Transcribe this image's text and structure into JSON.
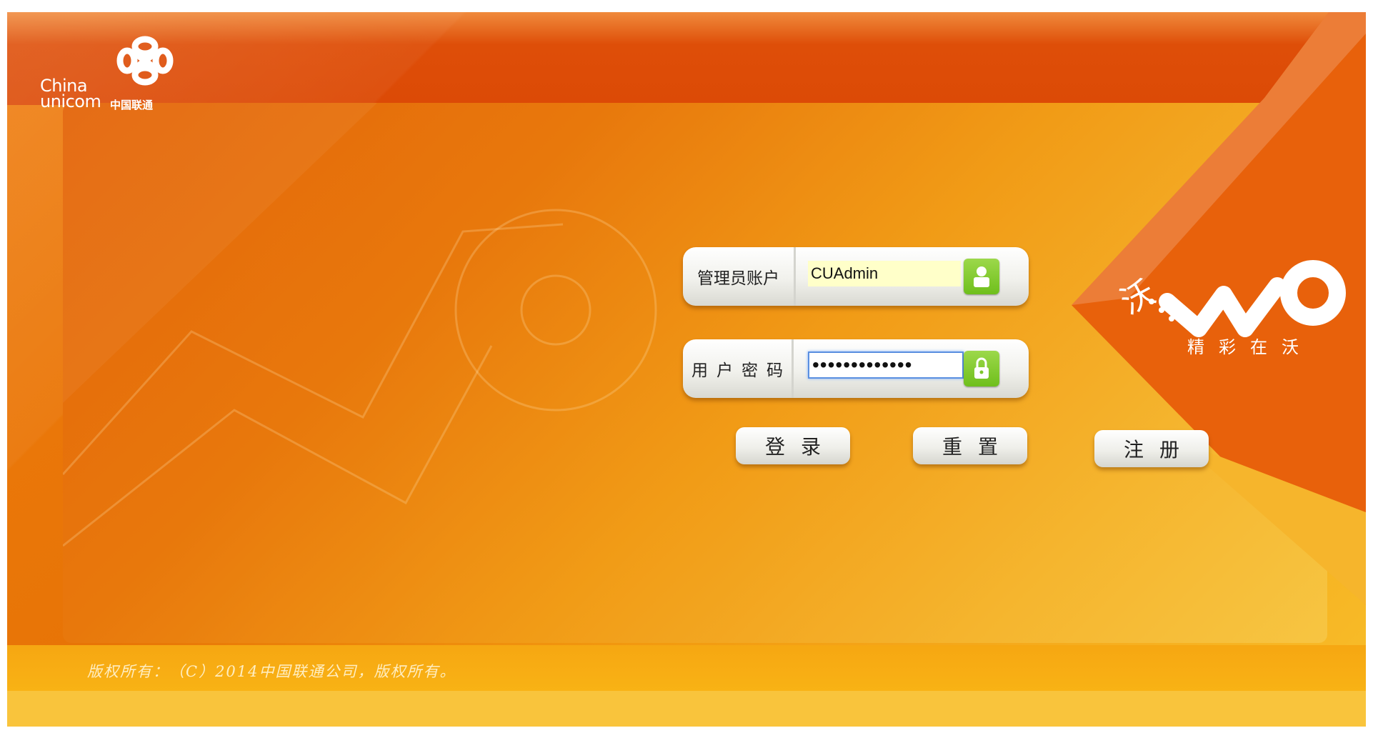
{
  "brand": {
    "name_en": "China\nunicom",
    "name_cn": "中国联通"
  },
  "form": {
    "account_label": "管理员账户",
    "account_value": "CUAdmin",
    "password_label": "用户密码",
    "password_value": "•••••••••••••"
  },
  "buttons": {
    "login": "登录",
    "reset": "重置",
    "register": "注册"
  },
  "wo": {
    "char": "沃",
    "slogan": "精彩在沃"
  },
  "footer": {
    "copyright": "版权所有：（C）2014中国联通公司，版权所有。"
  },
  "colors": {
    "brand_orange": "#e8740a",
    "brand_red": "#dc4a06",
    "accent_yellow": "#f8be2a",
    "lock_green": "#7cc72a"
  },
  "icons": {
    "user": "user-lock-icon",
    "password": "padlock-icon",
    "logo": "china-unicom-knot-logo",
    "wo": "wo-brand-logo"
  }
}
